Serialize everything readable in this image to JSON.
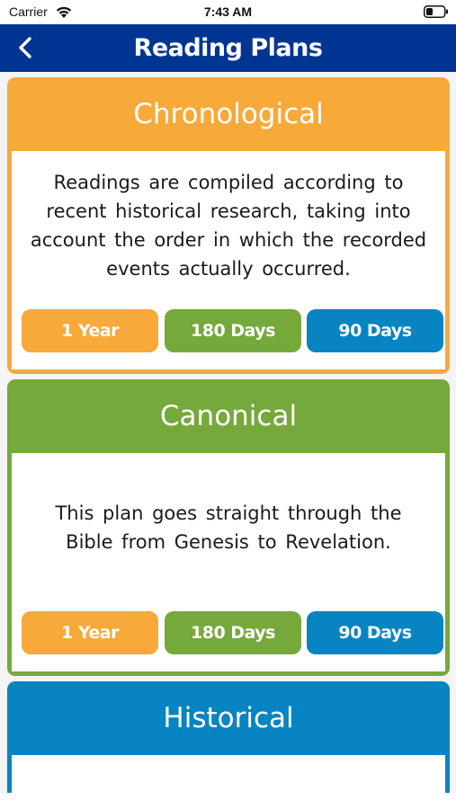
{
  "status_bar": {
    "carrier": "Carrier",
    "time": "7:43 AM",
    "wifi_icon": "wifi-icon",
    "battery_icon": "battery-icon"
  },
  "nav": {
    "title": "Reading Plans",
    "back_icon": "chevron-left-icon",
    "bar_color": "#003594"
  },
  "plans": [
    {
      "name": "Chronological",
      "color": "#f7a93a",
      "description": "Readings are compiled according to recent historical research, taking into account the order in which the recorded events actually occurred.",
      "buttons": [
        "1 Year",
        "180 Days",
        "90 Days"
      ]
    },
    {
      "name": "Canonical",
      "color": "#76a93b",
      "description": "This plan goes straight through the Bible from Genesis to Revelation.",
      "buttons": [
        "1 Year",
        "180 Days",
        "90 Days"
      ]
    },
    {
      "name": "Historical",
      "color": "#0784c2"
    }
  ],
  "button_colors": {
    "year": "#f7a93a",
    "days_180": "#76a93b",
    "days_90": "#0784c2"
  }
}
